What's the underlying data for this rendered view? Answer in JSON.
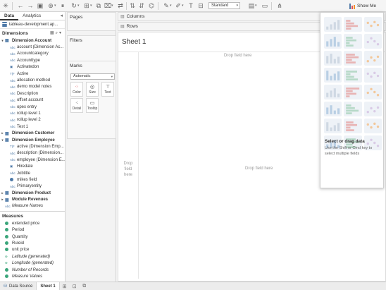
{
  "toolbar": {
    "view_mode": "Standard",
    "show_me_label": "Show Me"
  },
  "data_pane": {
    "tabs": [
      "Data",
      "Analytics"
    ],
    "datasource": "tableau-development.ap...",
    "dimensions_label": "Dimensions",
    "measures_label": "Measures"
  },
  "dimension_rows": [
    {
      "text": "Dimension Account",
      "kind": "table",
      "icon": "table-icon"
    },
    {
      "text": "account (Dimension Ac...",
      "kind": "field",
      "icon": "text-field-icon"
    },
    {
      "text": "Accountcategory",
      "kind": "field",
      "icon": "text-field-icon"
    },
    {
      "text": "Accounttype",
      "kind": "field",
      "icon": "text-field-icon"
    },
    {
      "text": "Activatedon",
      "kind": "field",
      "icon": "date-field-icon"
    },
    {
      "text": "Active",
      "kind": "field",
      "icon": "boolean-field-icon"
    },
    {
      "text": "allocation method",
      "kind": "field",
      "icon": "text-field-icon"
    },
    {
      "text": "demo model notes",
      "kind": "field",
      "icon": "text-field-icon"
    },
    {
      "text": "Description",
      "kind": "field",
      "icon": "text-field-icon"
    },
    {
      "text": "offset account",
      "kind": "field",
      "icon": "text-field-icon"
    },
    {
      "text": "opex entry",
      "kind": "field",
      "icon": "text-field-icon"
    },
    {
      "text": "rollup level 1",
      "kind": "field",
      "icon": "text-field-icon"
    },
    {
      "text": "rollup level 2",
      "kind": "field",
      "icon": "text-field-icon"
    },
    {
      "text": "Test 1",
      "kind": "field",
      "icon": "text-field-icon"
    },
    {
      "text": "Dimension Customer",
      "kind": "table-collapsed",
      "icon": "table-icon"
    },
    {
      "text": "Dimension Employee",
      "kind": "table",
      "icon": "table-icon"
    },
    {
      "text": "active (Dimension Emp...",
      "kind": "field",
      "icon": "boolean-field-icon"
    },
    {
      "text": "description (Dimension...",
      "kind": "field",
      "icon": "text-field-icon"
    },
    {
      "text": "employee (Dimension E...",
      "kind": "field",
      "icon": "text-field-icon"
    },
    {
      "text": "Hiredate",
      "kind": "field",
      "icon": "date-field-icon"
    },
    {
      "text": "Jobtitle",
      "kind": "field",
      "icon": "text-field-icon"
    },
    {
      "text": "mikes field",
      "kind": "field",
      "icon": "number-field-icon"
    },
    {
      "text": "Primaryentity",
      "kind": "field",
      "icon": "text-field-icon"
    },
    {
      "text": "Dimension Product",
      "kind": "table-collapsed",
      "icon": "table-icon"
    },
    {
      "text": "Module Revenues",
      "kind": "table-collapsed",
      "icon": "table-icon"
    },
    {
      "text": "Measure Names",
      "kind": "italic",
      "icon": "text-field-icon"
    }
  ],
  "measure_rows": [
    {
      "text": "extended price",
      "kind": "field",
      "icon": "measure-icon"
    },
    {
      "text": "Period",
      "kind": "field",
      "icon": "measure-icon"
    },
    {
      "text": "Quantity",
      "kind": "field",
      "icon": "measure-icon"
    },
    {
      "text": "Ruleid",
      "kind": "field",
      "icon": "measure-icon"
    },
    {
      "text": "unit price",
      "kind": "field",
      "icon": "measure-icon"
    },
    {
      "text": "Latitude (generated)",
      "kind": "italic",
      "icon": "globe-icon"
    },
    {
      "text": "Longitude (generated)",
      "kind": "italic",
      "icon": "globe-icon"
    },
    {
      "text": "Number of Records",
      "kind": "italic",
      "icon": "measure-icon"
    },
    {
      "text": "Measure Values",
      "kind": "italic",
      "icon": "measure-icon"
    }
  ],
  "cards": {
    "pages": "Pages",
    "filters": "Filters",
    "marks": "Marks",
    "mark_type": "Automatic",
    "buttons": [
      "Color",
      "Size",
      "Text",
      "Detail",
      "Tooltip"
    ]
  },
  "shelves": {
    "columns": "Columns",
    "rows": "Rows"
  },
  "sheet": {
    "title": "Sheet 1",
    "drop_field_here": "Drop field here",
    "drop_rows": "Drop field here"
  },
  "show_me": {
    "hint_title": "Select or drag data",
    "hint_text": "Use the Shift or Cmd key to select multiple fields"
  },
  "bottom_tabs": {
    "data_source": "Data Source",
    "sheet": "Sheet 1"
  },
  "colors": {
    "tableau_blue": "#4e79a7",
    "measure_green": "#3aa57a"
  }
}
